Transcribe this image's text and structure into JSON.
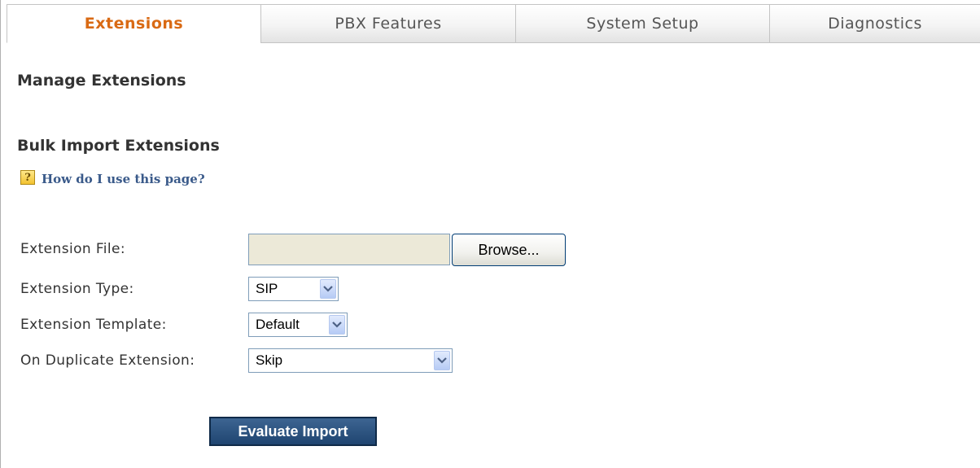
{
  "tabs": [
    {
      "label": "Extensions",
      "active": true
    },
    {
      "label": "PBX Features",
      "active": false
    },
    {
      "label": "System Setup",
      "active": false
    },
    {
      "label": "Diagnostics",
      "active": false
    }
  ],
  "page": {
    "title": "Manage Extensions",
    "section_title": "Bulk Import Extensions",
    "help_icon": "?",
    "help_link": "How do I use this page?"
  },
  "form": {
    "extension_file": {
      "label": "Extension File:",
      "value": "",
      "browse_label": "Browse..."
    },
    "extension_type": {
      "label": "Extension Type:",
      "selected": "SIP"
    },
    "extension_template": {
      "label": "Extension Template:",
      "selected": "Default"
    },
    "on_duplicate": {
      "label": "On Duplicate Extension:",
      "selected": "Skip"
    },
    "submit_label": "Evaluate Import"
  },
  "colors": {
    "active_tab": "#d96a14",
    "help_link": "#3a5a8a",
    "primary_button": "#1f4570"
  },
  "icons": {
    "help": "help-icon",
    "dropdown": "chevron-down-icon"
  }
}
